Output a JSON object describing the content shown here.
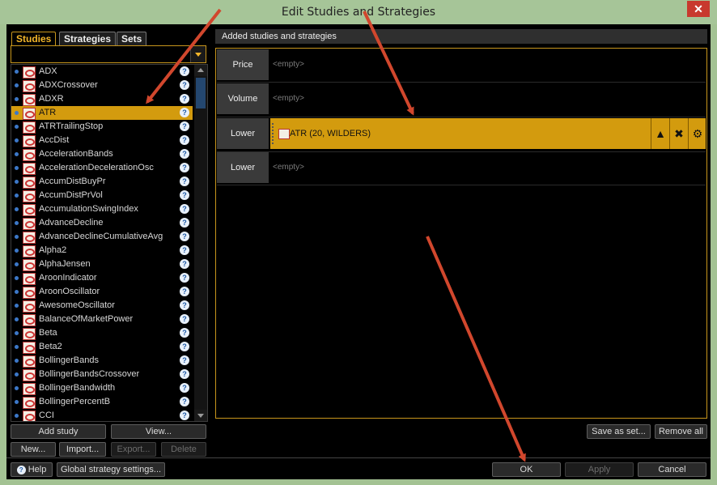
{
  "window": {
    "title": "Edit Studies and Strategies",
    "close_label": "✕"
  },
  "tabs": [
    "Studies",
    "Strategies",
    "Sets"
  ],
  "studies": [
    "ADX",
    "ADXCrossover",
    "ADXR",
    "ATR",
    "ATRTrailingStop",
    "AccDist",
    "AccelerationBands",
    "AccelerationDecelerationOsc",
    "AccumDistBuyPr",
    "AccumDistPrVol",
    "AccumulationSwingIndex",
    "AdvanceDecline",
    "AdvanceDeclineCumulativeAvg",
    "Alpha2",
    "AlphaJensen",
    "AroonIndicator",
    "AroonOscillator",
    "AwesomeOscillator",
    "BalanceOfMarketPower",
    "Beta",
    "Beta2",
    "BollingerBands",
    "BollingerBandsCrossover",
    "BollingerBandwidth",
    "BollingerPercentB",
    "CCI"
  ],
  "selected_study": "ATR",
  "left_buttons": {
    "add_study": "Add study",
    "view": "View...",
    "new": "New...",
    "import": "Import...",
    "export": "Export...",
    "delete": "Delete"
  },
  "right_panel": {
    "header": "Added studies and strategies",
    "slots": [
      {
        "label": "Price",
        "value": "<empty>"
      },
      {
        "label": "Volume",
        "value": "<empty>"
      },
      {
        "label": "Lower",
        "value": "ATR (20, WILDERS)"
      },
      {
        "label": "Lower",
        "value": "<empty>"
      }
    ],
    "save_as_set": "Save as set...",
    "remove_all": "Remove all"
  },
  "footer": {
    "help": "Help",
    "global_settings": "Global strategy settings...",
    "ok": "OK",
    "apply": "Apply",
    "cancel": "Cancel"
  },
  "colors": {
    "accent": "#d39b0e",
    "tab_active": "#f3b62a",
    "arrow": "#d1472d"
  }
}
